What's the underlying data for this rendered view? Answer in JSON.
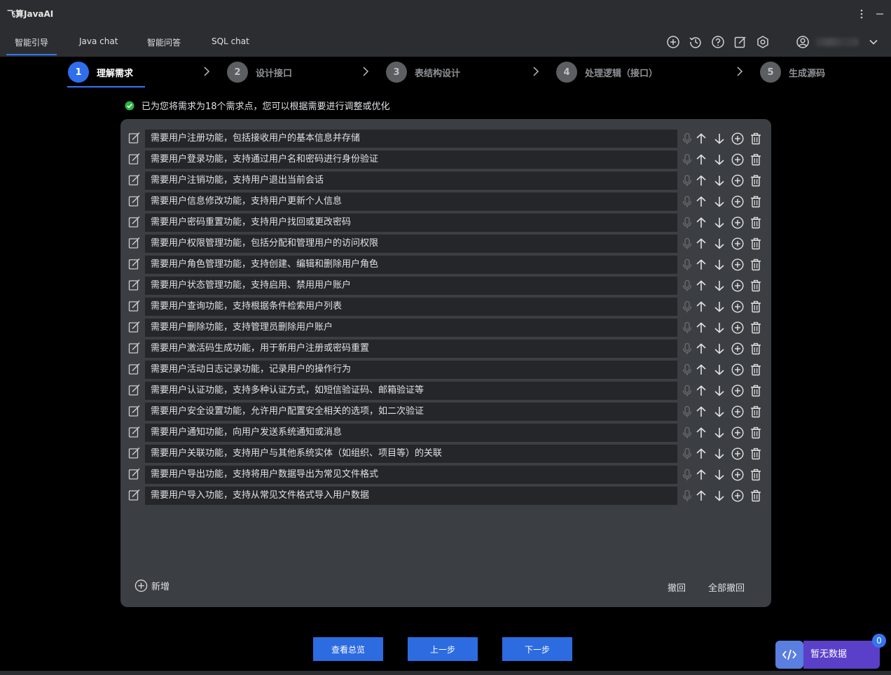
{
  "app": {
    "title": "飞算JavaAI"
  },
  "tabs": [
    {
      "label": "智能引导"
    },
    {
      "label": "Java chat"
    },
    {
      "label": "智能问答"
    },
    {
      "label": "SQL chat"
    }
  ],
  "steps": [
    {
      "num": "1",
      "label": "理解需求"
    },
    {
      "num": "2",
      "label": "设计接口"
    },
    {
      "num": "3",
      "label": "表结构设计"
    },
    {
      "num": "4",
      "label": "处理逻辑（接口）"
    },
    {
      "num": "5",
      "label": "生成源码"
    }
  ],
  "notice": "已为您将需求为18个需求点，您可以根据需要进行调整或优化",
  "requirements": [
    "需要用户注册功能，包括接收用户的基本信息并存储",
    "需要用户登录功能，支持通过用户名和密码进行身份验证",
    "需要用户注销功能，支持用户退出当前会话",
    "需要用户信息修改功能，支持用户更新个人信息",
    "需要用户密码重置功能，支持用户找回或更改密码",
    "需要用户权限管理功能，包括分配和管理用户的访问权限",
    "需要用户角色管理功能，支持创建、编辑和删除用户角色",
    "需要用户状态管理功能，支持启用、禁用用户账户",
    "需要用户查询功能，支持根据条件检索用户列表",
    "需要用户删除功能，支持管理员删除用户账户",
    "需要用户激活码生成功能，用于新用户注册或密码重置",
    "需要用户活动日志记录功能，记录用户的操作行为",
    "需要用户认证功能，支持多种认证方式，如短信验证码、邮箱验证等",
    "需要用户安全设置功能，允许用户配置安全相关的选项，如二次验证",
    "需要用户通知功能，向用户发送系统通知或消息",
    "需要用户关联功能，支持用户与其他系统实体（如组织、项目等）的关联",
    "需要用户导出功能，支持将用户数据导出为常见文件格式",
    "需要用户导入功能，支持从常见文件格式导入用户数据"
  ],
  "panel": {
    "add_label": "新增",
    "undo_label": "撤回",
    "undo_all_label": "全部撤回"
  },
  "buttons": {
    "overview": "查看总览",
    "prev": "上一步",
    "next": "下一步"
  },
  "floating": {
    "label": "暂无数据",
    "badge": "0"
  },
  "colors": {
    "accent": "#3574f0",
    "button": "#2d6be0",
    "success": "#2fb344",
    "panel": "#3b3e42",
    "badge_panel": "#5a3fc8"
  }
}
